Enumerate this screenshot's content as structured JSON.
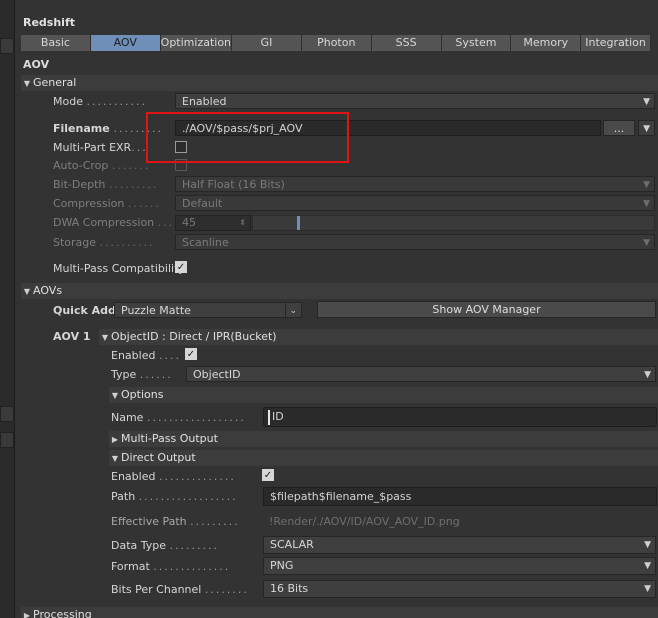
{
  "panel_title": "Redshift",
  "tabs": [
    "Basic",
    "AOV",
    "Optimization",
    "GI",
    "Photon",
    "SSS",
    "System",
    "Memory",
    "Integration"
  ],
  "active_tab": "AOV",
  "section_title": "AOV",
  "general": {
    "header": "General",
    "mode_label": "Mode",
    "mode_value": "Enabled",
    "filename_label": "Filename",
    "filename_value": "./AOV/$pass/$prj_AOV",
    "browse_label": "...",
    "multipart_label": "Multi-Part EXR",
    "autocrop_label": "Auto-Crop",
    "bitdepth_label": "Bit-Depth",
    "bitdepth_value": "Half Float (16 Bits)",
    "compression_label": "Compression",
    "compression_value": "Default",
    "dwa_label": "DWA Compression",
    "dwa_value": "45",
    "dwa_fraction": 0.11,
    "storage_label": "Storage",
    "storage_value": "Scanline",
    "multipass_label": "Multi-Pass Compatibility"
  },
  "aovs": {
    "header": "AOVs",
    "quick_add_label": "Quick Add",
    "quick_add_value": "Puzzle Matte",
    "show_manager_label": "Show AOV Manager",
    "aov1_label": "AOV 1",
    "aov1_header": "ObjectID : Direct / IPR(Bucket)",
    "enabled_label": "Enabled",
    "type_label": "Type",
    "type_value": "ObjectID",
    "options_header": "Options",
    "name_label": "Name",
    "name_value": "ID",
    "multipass_output_header": "Multi-Pass Output",
    "direct_output_header": "Direct Output",
    "do_enabled_label": "Enabled",
    "path_label": "Path",
    "path_value": "$filepath$filename_$pass",
    "effective_path_label": "Effective Path",
    "effective_path_value": "!Render/./AOV/ID/AOV_AOV_ID.png",
    "data_type_label": "Data Type",
    "data_type_value": "SCALAR",
    "format_label": "Format",
    "format_value": "PNG",
    "bpc_label": "Bits Per Channel",
    "bpc_value": "16 Bits"
  },
  "processing_header": "Processing",
  "check_glyph": "✓",
  "accent_color": "#6f8fb8",
  "highlight_color": "#e01414"
}
